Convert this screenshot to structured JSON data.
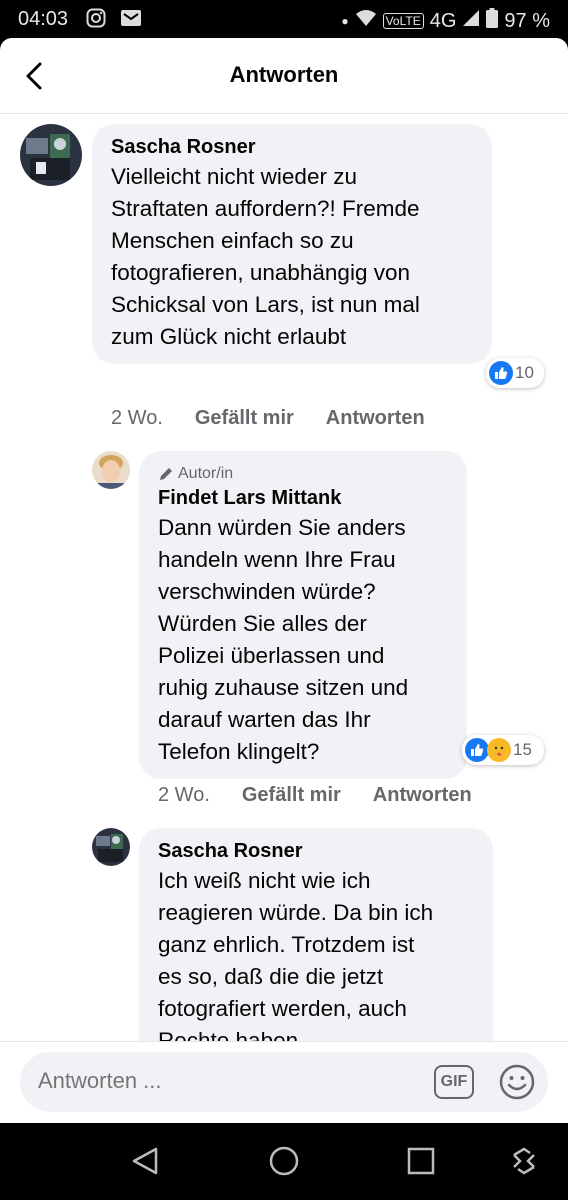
{
  "status_bar": {
    "time": "04:03",
    "network": "4G",
    "volte": "VoLTE",
    "battery": "97 %"
  },
  "header": {
    "title": "Antworten",
    "back_icon": "chevron-left-icon"
  },
  "comments": [
    {
      "author": "Sascha Rosner",
      "text": "Vielleicht nicht wieder zu\nStraftaten auffordern?! Fremde\nMenschen einfach so zu\nfotografieren, unabhängig von\nSchicksal von Lars, ist nun mal\nzum Glück nicht erlaubt",
      "reaction_count": "10",
      "time": "2 Wo.",
      "like_label": "Gefällt mir",
      "reply_label": "Antworten"
    },
    {
      "badge": "Autor/in",
      "author": "Findet Lars Mittank",
      "text": "Dann würden Sie anders\nhandeln wenn Ihre Frau\nverschwinden würde?\nWürden Sie alles der\nPolizei überlassen und\nruhig zuhause sitzen und\ndarauf warten das Ihr\nTelefon klingelt?",
      "reaction_count": "15",
      "time": "2 Wo.",
      "like_label": "Gefällt mir",
      "reply_label": "Antworten"
    },
    {
      "author": "Sascha Rosner",
      "text": "Ich weiß nicht wie ich\nreagieren würde. Da bin ich\nganz ehrlich. Trotzdem ist\nes so, daß die die jetzt\nfotografiert werden, auch\nRechte haben.\nGibt es denn Hinweise oder"
    }
  ],
  "composer": {
    "placeholder": "Antworten ...",
    "gif_label": "GIF"
  },
  "colors": {
    "brand_blue": "#1877f2",
    "bubble_bg": "#f0f2f5",
    "secondary_text": "#65676b"
  }
}
